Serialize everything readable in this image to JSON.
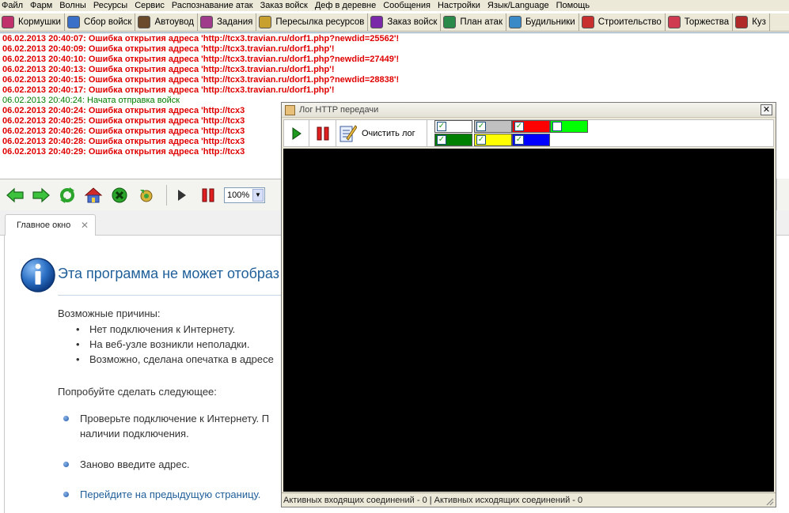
{
  "menu": [
    "Файл",
    "Фарм",
    "Волны",
    "Ресурсы",
    "Сервис",
    "Распознавание атак",
    "Заказ войск",
    "Деф в деревне",
    "Сообщения",
    "Настройки",
    "Язык/Language",
    "Помощь"
  ],
  "toolbar": [
    {
      "label": "Кормушки",
      "icon": "feeder-icon",
      "color": "#c0306a"
    },
    {
      "label": "Сбор войск",
      "icon": "globe-icon",
      "color": "#3a70c8"
    },
    {
      "label": "Автоувод",
      "icon": "soldier-icon",
      "color": "#6a4a2a"
    },
    {
      "label": "Задания",
      "icon": "tasks-icon",
      "color": "#a03a8a"
    },
    {
      "label": "Пересылка ресурсов",
      "icon": "resources-icon",
      "color": "#c8a030"
    },
    {
      "label": "Заказ войск",
      "icon": "order-troops-icon",
      "color": "#7a2aa8"
    },
    {
      "label": "План атак",
      "icon": "attack-plan-icon",
      "color": "#2a8a4a"
    },
    {
      "label": "Будильники",
      "icon": "alarm-icon",
      "color": "#3a8ac8"
    },
    {
      "label": "Строительство",
      "icon": "building-icon",
      "color": "#c83030"
    },
    {
      "label": "Торжества",
      "icon": "celebration-icon",
      "color": "#d03a50"
    },
    {
      "label": "Куз",
      "icon": "smith-icon",
      "color": "#b02a2a"
    }
  ],
  "log": [
    {
      "text": "06.02.2013 20:40:07: Ошибка открытия адреса 'http://tcx3.travian.ru/dorf1.php?newdid=25562'!",
      "kind": "error"
    },
    {
      "text": "06.02.2013 20:40:09: Ошибка открытия адреса 'http://tcx3.travian.ru/dorf1.php'!",
      "kind": "error"
    },
    {
      "text": "06.02.2013 20:40:10: Ошибка открытия адреса 'http://tcx3.travian.ru/dorf1.php?newdid=27449'!",
      "kind": "error"
    },
    {
      "text": "06.02.2013 20:40:13: Ошибка открытия адреса 'http://tcx3.travian.ru/dorf1.php'!",
      "kind": "error"
    },
    {
      "text": "06.02.2013 20:40:15: Ошибка открытия адреса 'http://tcx3.travian.ru/dorf1.php?newdid=28838'!",
      "kind": "error"
    },
    {
      "text": "06.02.2013 20:40:17: Ошибка открытия адреса 'http://tcx3.travian.ru/dorf1.php'!",
      "kind": "error"
    },
    {
      "text": "06.02.2013 20:40:24: Начата отправка войск",
      "kind": "ok"
    },
    {
      "text": "06.02.2013 20:40:24: Ошибка открытия адреса 'http://tcx3",
      "kind": "error"
    },
    {
      "text": "06.02.2013 20:40:25: Ошибка открытия адреса 'http://tcx3",
      "kind": "error"
    },
    {
      "text": "06.02.2013 20:40:26: Ошибка открытия адреса 'http://tcx3",
      "kind": "error"
    },
    {
      "text": "06.02.2013 20:40:28: Ошибка открытия адреса 'http://tcx3",
      "kind": "error"
    },
    {
      "text": "06.02.2013 20:40:29: Ошибка открытия адреса 'http://tcx3",
      "kind": "error"
    }
  ],
  "nav": {
    "zoom": "100%"
  },
  "tab": {
    "label": "Главное окно"
  },
  "error_page": {
    "title": "Эта программа не может отобраз",
    "causes_header": "Возможные причины:",
    "causes": [
      "Нет подключения к Интернету.",
      "На веб-узле возникли неполадки.",
      "Возможно, сделана опечатка в адресе"
    ],
    "try_header": "Попробуйте сделать следующее:",
    "suggestion1_line1": "Проверьте подключение к Интернету. П",
    "suggestion1_line2": "наличии подключения.",
    "suggestion2": "Заново введите адрес.",
    "suggestion3_link": "Перейдите на предыдущую страницу."
  },
  "http_dialog": {
    "title": "Лог HTTP передачи",
    "clear_label": "Очистить лог",
    "colors": [
      {
        "color": "#ffffff",
        "checked": true
      },
      {
        "color": "#c0c0c0",
        "checked": true
      },
      {
        "color": "#ff0000",
        "checked": true
      },
      {
        "color": "#00ff00",
        "checked": false
      },
      {
        "color": "#008000",
        "checked": true
      },
      {
        "color": "#ffff00",
        "checked": true
      },
      {
        "color": "#0000ff",
        "checked": true
      }
    ],
    "status": "Активных входящих соединений - 0 | Активных исходящих соединений - 0"
  }
}
